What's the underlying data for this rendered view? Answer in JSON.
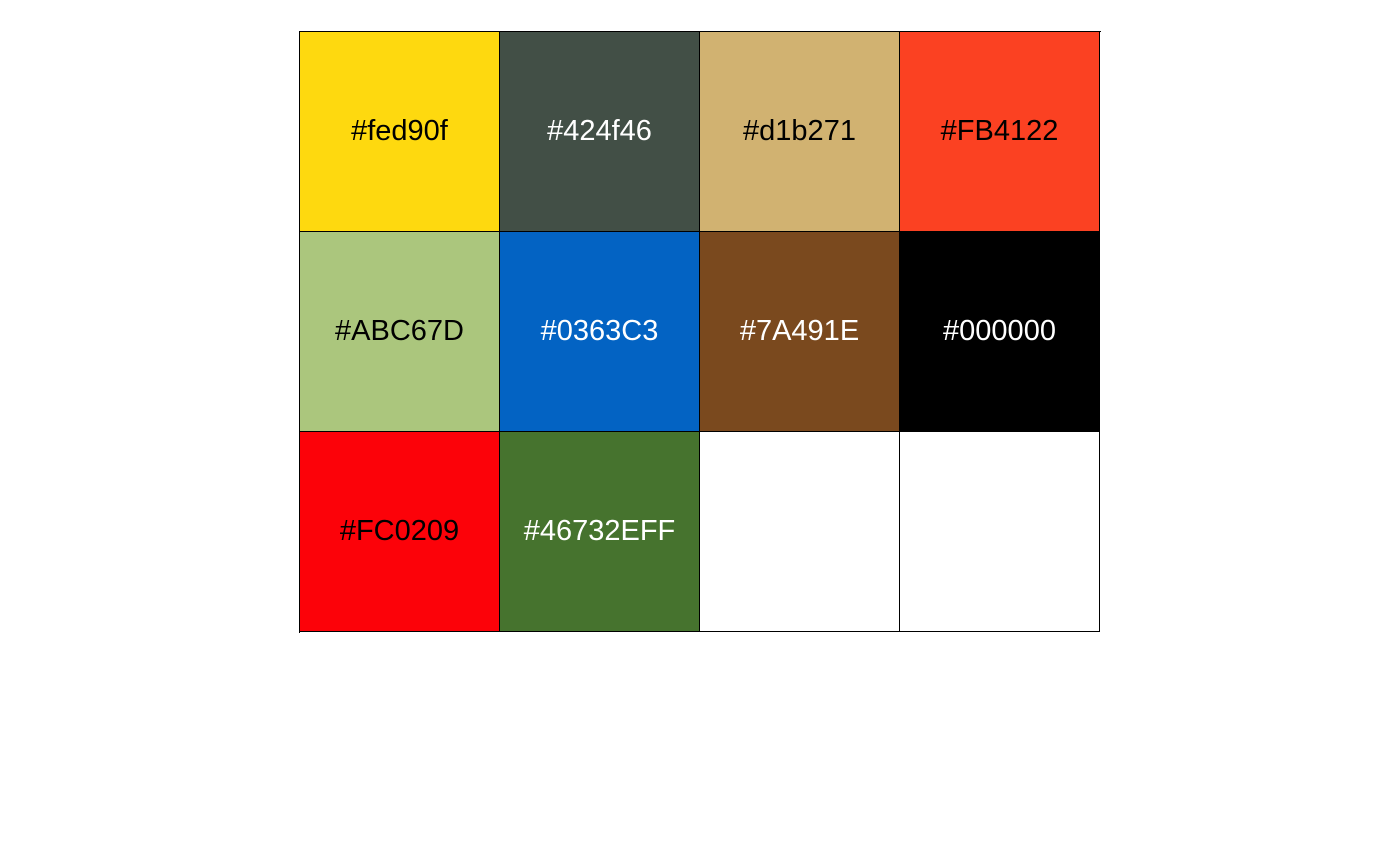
{
  "palette": {
    "swatches": [
      {
        "label": "#fed90f",
        "color": "#fed90f",
        "text_color": "#000000"
      },
      {
        "label": "#424f46",
        "color": "#424f46",
        "text_color": "#ffffff"
      },
      {
        "label": "#d1b271",
        "color": "#d1b271",
        "text_color": "#000000"
      },
      {
        "label": "#FB4122",
        "color": "#FB4122",
        "text_color": "#000000"
      },
      {
        "label": "#ABC67D",
        "color": "#ABC67D",
        "text_color": "#000000"
      },
      {
        "label": "#0363C3",
        "color": "#0363C3",
        "text_color": "#ffffff"
      },
      {
        "label": "#7A491E",
        "color": "#7A491E",
        "text_color": "#ffffff"
      },
      {
        "label": "#000000",
        "color": "#000000",
        "text_color": "#ffffff"
      },
      {
        "label": "#FC0209",
        "color": "#FC0209",
        "text_color": "#000000"
      },
      {
        "label": "#46732EFF",
        "color": "#46732E",
        "text_color": "#ffffff"
      },
      {
        "label": "",
        "color": "#ffffff",
        "text_color": "#000000"
      },
      {
        "label": "",
        "color": "#ffffff",
        "text_color": "#000000"
      }
    ]
  }
}
